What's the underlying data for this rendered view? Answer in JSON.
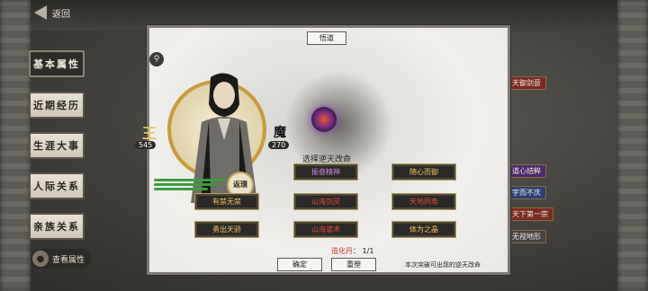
{
  "header": {
    "back_label": "返回"
  },
  "sidebar": {
    "items": [
      {
        "label": "基本属性",
        "active": true
      },
      {
        "label": "近期经历",
        "active": false
      },
      {
        "label": "生涯大事",
        "active": false
      },
      {
        "label": "人际关系",
        "active": false
      },
      {
        "label": "亲族关系",
        "active": false
      }
    ],
    "view_attributes": "查看属性"
  },
  "right_tags": [
    {
      "label": "天御剑意",
      "color": "#7a2a24"
    },
    {
      "label": "道心结粹",
      "color": "#4b2a6e"
    },
    {
      "label": "宇而不庆",
      "color": "#2c3f7a"
    },
    {
      "label": "天下第一宗",
      "color": "#7a2a24"
    },
    {
      "label": "无视地形",
      "color": "#444"
    }
  ],
  "modal": {
    "title": "悟道",
    "character": {
      "rank_left": "王",
      "value_left": "545",
      "realm": "魔",
      "value_right": "270",
      "badge": "返璞"
    },
    "choose_label": "选择逆天改命",
    "options": [
      {
        "label": "振奋精神",
        "style": "purple"
      },
      {
        "label": "随心而御",
        "style": "gold"
      },
      {
        "label": "有禁无禁",
        "style": "gold"
      },
      {
        "label": "山海剑灵",
        "style": "red"
      },
      {
        "label": "天地同寿",
        "style": "red"
      },
      {
        "label": "勇出天骄",
        "style": "gold"
      },
      {
        "label": "山海道术",
        "style": "red"
      },
      {
        "label": "体为之晶",
        "style": "gold"
      }
    ],
    "pill_label": "造化丹",
    "pill_count": "1/1",
    "confirm_label": "确定",
    "reset_label": "重塑",
    "note": "本次突破可出现的逆天改命"
  }
}
